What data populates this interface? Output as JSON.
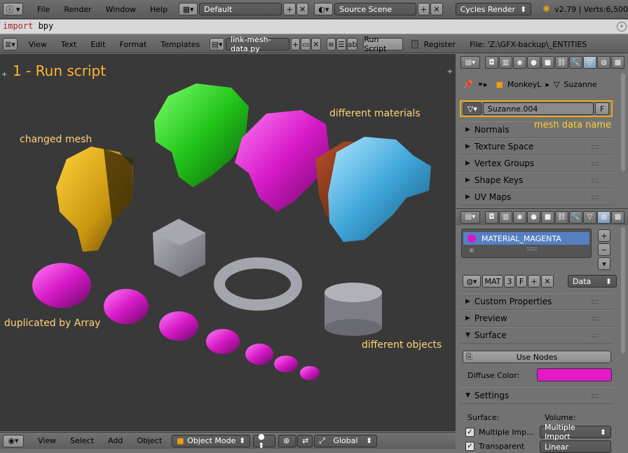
{
  "topbar": {
    "menus": [
      "File",
      "Render",
      "Window",
      "Help"
    ],
    "layout": "Default",
    "scene": "Source Scene",
    "engine": "Cycles Render",
    "version": "v2.79 | Verts:6,500"
  },
  "console": {
    "keyword": "import",
    "rest": " bpy"
  },
  "text_editor": {
    "menus": [
      "View",
      "Text",
      "Edit",
      "Format",
      "Templates"
    ],
    "filename": "link-mesh-data.py",
    "run_script": "Run Script",
    "register": "Register",
    "file_path": "File: 'Z:\\GFX-backup\\_ENTITIES"
  },
  "viewport": {
    "title": "1 - Run script",
    "labels": {
      "changed_mesh": "changed mesh",
      "different_materials": "different materials",
      "duplicated_by_array": "duplicated by Array",
      "different_objects": "different objects"
    }
  },
  "bottombar": {
    "menus": [
      "View",
      "Select",
      "Add",
      "Object"
    ],
    "mode": "Object Mode",
    "orientation": "Global"
  },
  "properties_top": {
    "breadcrumb": [
      "MonkeyL",
      "Suzanne"
    ],
    "mesh_name": "Suzanne.004",
    "fake_user": "F",
    "annotation": "mesh data name",
    "panels": [
      "Normals",
      "Texture Space",
      "Vertex Groups",
      "Shape Keys",
      "UV Maps"
    ]
  },
  "properties_material": {
    "slot": "MATERIAL_MAGENTA",
    "mat_label": "MAT",
    "users": "3",
    "fake_user": "F",
    "link": "Data",
    "panels": [
      "Custom Properties",
      "Preview",
      "Surface"
    ],
    "use_nodes": "Use Nodes",
    "diffuse_label": "Diffuse Color:",
    "diffuse_color": "#e619c8",
    "settings": "Settings",
    "surface_label": "Surface:",
    "volume_label": "Volume:",
    "multiple_importance": "Multiple Imp...",
    "volume_value": "Multiple Import",
    "transparent": "Transparent",
    "linear": "Linear"
  }
}
